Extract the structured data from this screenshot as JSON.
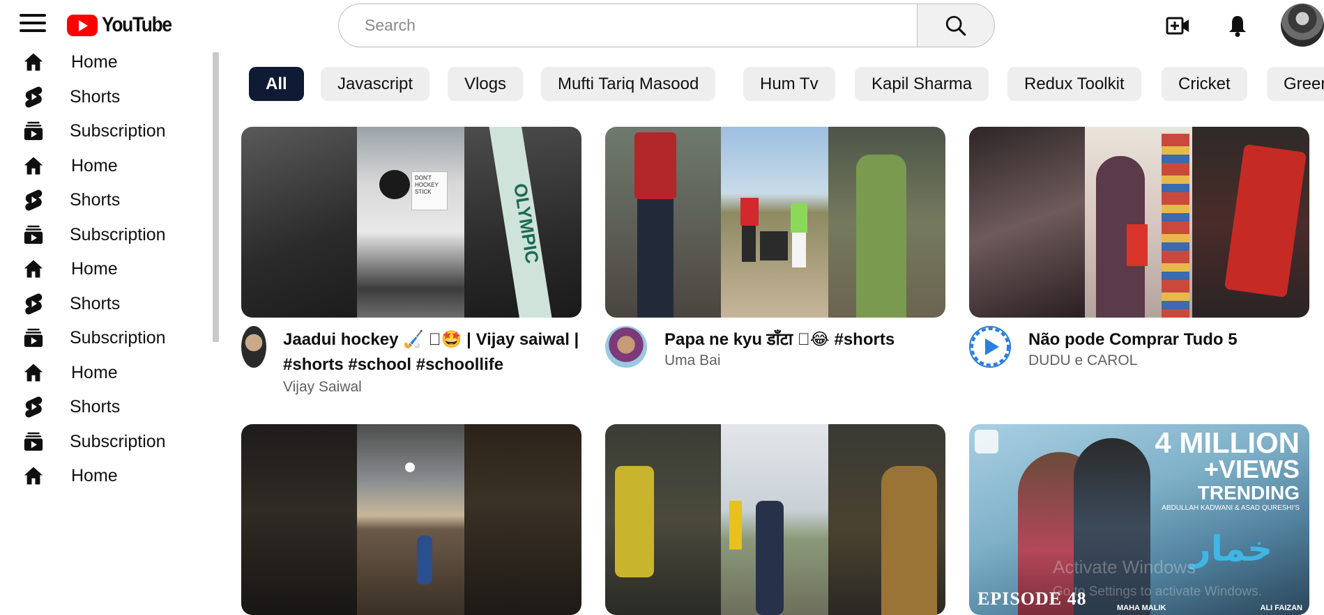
{
  "header": {
    "logo_text": "YouTube",
    "search_placeholder": "Search"
  },
  "sidebar": {
    "items": [
      {
        "label": "Home",
        "icon": "home-icon"
      },
      {
        "label": "Shorts",
        "icon": "shorts-icon"
      },
      {
        "label": "Subscription",
        "icon": "subscription-icon"
      },
      {
        "label": "Home",
        "icon": "home-icon"
      },
      {
        "label": "Shorts",
        "icon": "shorts-icon"
      },
      {
        "label": "Subscription",
        "icon": "subscription-icon"
      },
      {
        "label": "Home",
        "icon": "home-icon"
      },
      {
        "label": "Shorts",
        "icon": "shorts-icon"
      },
      {
        "label": "Subscription",
        "icon": "subscription-icon"
      },
      {
        "label": "Home",
        "icon": "home-icon"
      },
      {
        "label": "Shorts",
        "icon": "shorts-icon"
      },
      {
        "label": "Subscription",
        "icon": "subscription-icon"
      },
      {
        "label": "Home",
        "icon": "home-icon"
      }
    ]
  },
  "chips": [
    "All",
    "Javascript",
    "Vlogs",
    "Mufti Tariq Masood",
    "Hum Tv",
    "Kapil Sharma",
    "Redux Toolkit",
    "Cricket",
    "Green"
  ],
  "videos": [
    {
      "title": "Jaadui hockey 🏑 ⃞🤩 | Vijay saiwal | #shorts #school #schoollife",
      "channel": "Vijay Saiwal"
    },
    {
      "title": "Papa ne kyu डाँटा ⃞😂 #shorts",
      "channel": "Uma Bai"
    },
    {
      "title": "Não pode Comprar Tudo 5",
      "channel": "DUDU e CAROL"
    }
  ],
  "thumb_text": {
    "v1_sign": "DON'T HOCKEY STICK",
    "v1_stick": "OLYMPIC",
    "v6_promo_line1": "4 MILLION",
    "v6_promo_line2": "+VIEWS",
    "v6_promo_line3": "TRENDING",
    "v6_credits": "ABDULLAH KADWANI & ASAD QURESHI'S",
    "v6_urdu": "خمار",
    "v6_episode": "EPISODE 48",
    "v6_writer": "MAHA MALIK",
    "v6_director": "ALI FAIZAN"
  },
  "overlay": {
    "activate_title": "Activate Windows",
    "activate_sub": "Go to Settings to activate Windows."
  },
  "colors": {
    "brand": "#ff0000",
    "chip_active": "#0f1b35",
    "chip_bg": "#eeeeee"
  }
}
